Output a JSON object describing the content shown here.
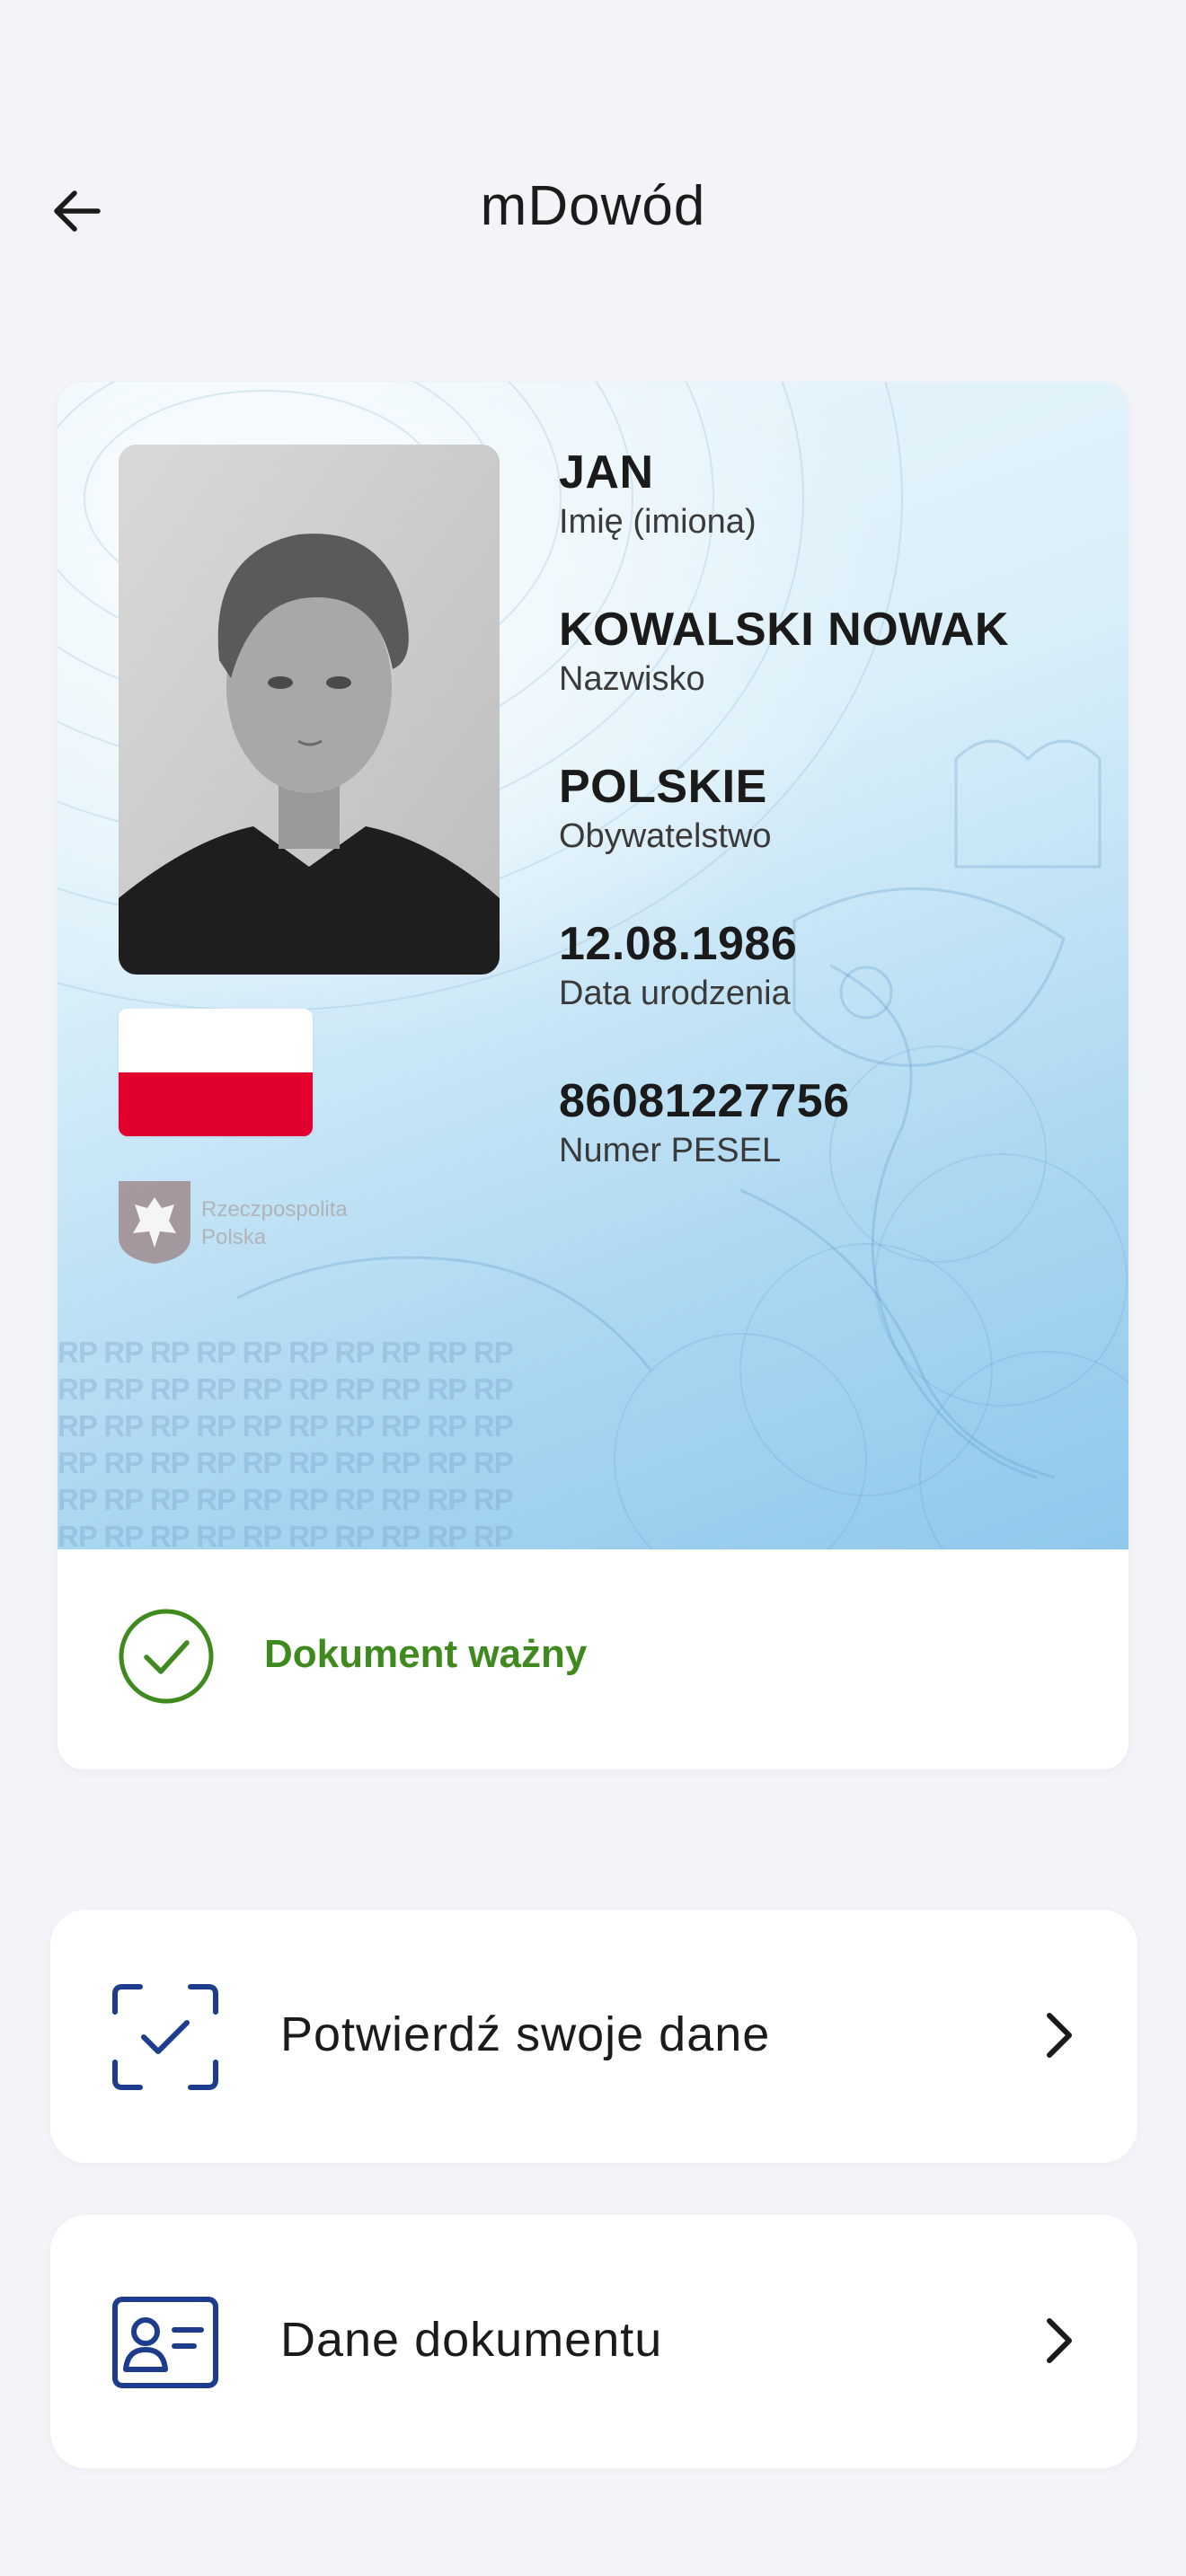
{
  "header": {
    "title": "mDowód",
    "back_icon": "arrow-left-icon"
  },
  "id_card": {
    "fields": [
      {
        "value": "JAN",
        "label": "Imię (imiona)"
      },
      {
        "value": "KOWALSKI NOWAK",
        "label": "Nazwisko"
      },
      {
        "value": "POLSKIE",
        "label": "Obywatelstwo"
      },
      {
        "value": "12.08.1986",
        "label": "Data urodzenia"
      },
      {
        "value": "86081227756",
        "label": "Numer PESEL"
      }
    ],
    "emblem_text_line1": "Rzeczpospolita",
    "emblem_text_line2": "Polska",
    "rp_text": "RP RP RP RP RP RP RP RP RP RP\nRP RP RP RP RP RP RP RP RP RP\nRP RP RP RP RP RP RP RP RP RP\nRP RP RP RP RP RP RP RP RP RP\nRP RP RP RP RP RP RP RP RP RP\nRP RP RP RP RP RP RP RP RP RP",
    "status": {
      "text": "Dokument ważny",
      "color": "#3f8a1f",
      "icon": "check-circle-icon"
    },
    "flag_colors": {
      "top": "#ffffff",
      "bottom": "#e2002f"
    }
  },
  "actions": [
    {
      "label": "Potwierdź swoje dane",
      "icon": "scan-check-icon"
    },
    {
      "label": "Dane dokumentu",
      "icon": "id-card-icon"
    }
  ],
  "colors": {
    "background": "#f2f4f8",
    "icon_blue": "#1e3c8c"
  }
}
